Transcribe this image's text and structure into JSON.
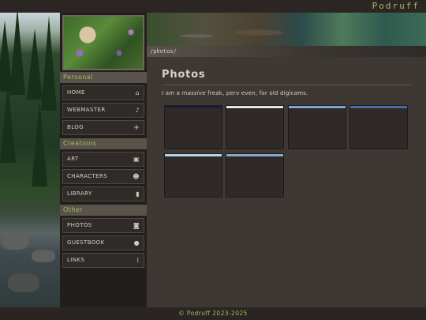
{
  "site": {
    "title": "Podruff"
  },
  "breadcrumb": {
    "path": "/photos/"
  },
  "sidebar": {
    "sections": [
      {
        "heading": "Personal",
        "items": [
          {
            "label": "HOME",
            "icon": "home-icon"
          },
          {
            "label": "WEBMASTER",
            "icon": "bell-icon"
          },
          {
            "label": "BLOG",
            "icon": "plane-icon"
          }
        ]
      },
      {
        "heading": "Creations",
        "items": [
          {
            "label": "ART",
            "icon": "image-icon"
          },
          {
            "label": "CHARACTERS",
            "icon": "users-icon"
          },
          {
            "label": "LIBRARY",
            "icon": "book-icon"
          }
        ]
      },
      {
        "heading": "Other",
        "items": [
          {
            "label": "PHOTOS",
            "icon": "camera-icon"
          },
          {
            "label": "GUESTBOOK",
            "icon": "chat-icon"
          },
          {
            "label": "LINKS",
            "icon": "paperclip-icon"
          }
        ]
      }
    ]
  },
  "main": {
    "title": "Photos",
    "intro_prefix": "I am a ",
    "intro_emph": "massive",
    "intro_suffix": " freak, perv even, for old digicams."
  },
  "gallery": {
    "strip_colors": [
      "#1a1e3a",
      "#e6e6e6",
      "#7ea6d6",
      "#4a6aa8",
      "#b7d3ec",
      "#8aa6c8"
    ]
  },
  "footer": {
    "text": "© Podruff 2023-2025"
  },
  "colors": {
    "accent": "#a7b95b",
    "panel": "#3e3835",
    "sidebar": "#221e1c"
  }
}
